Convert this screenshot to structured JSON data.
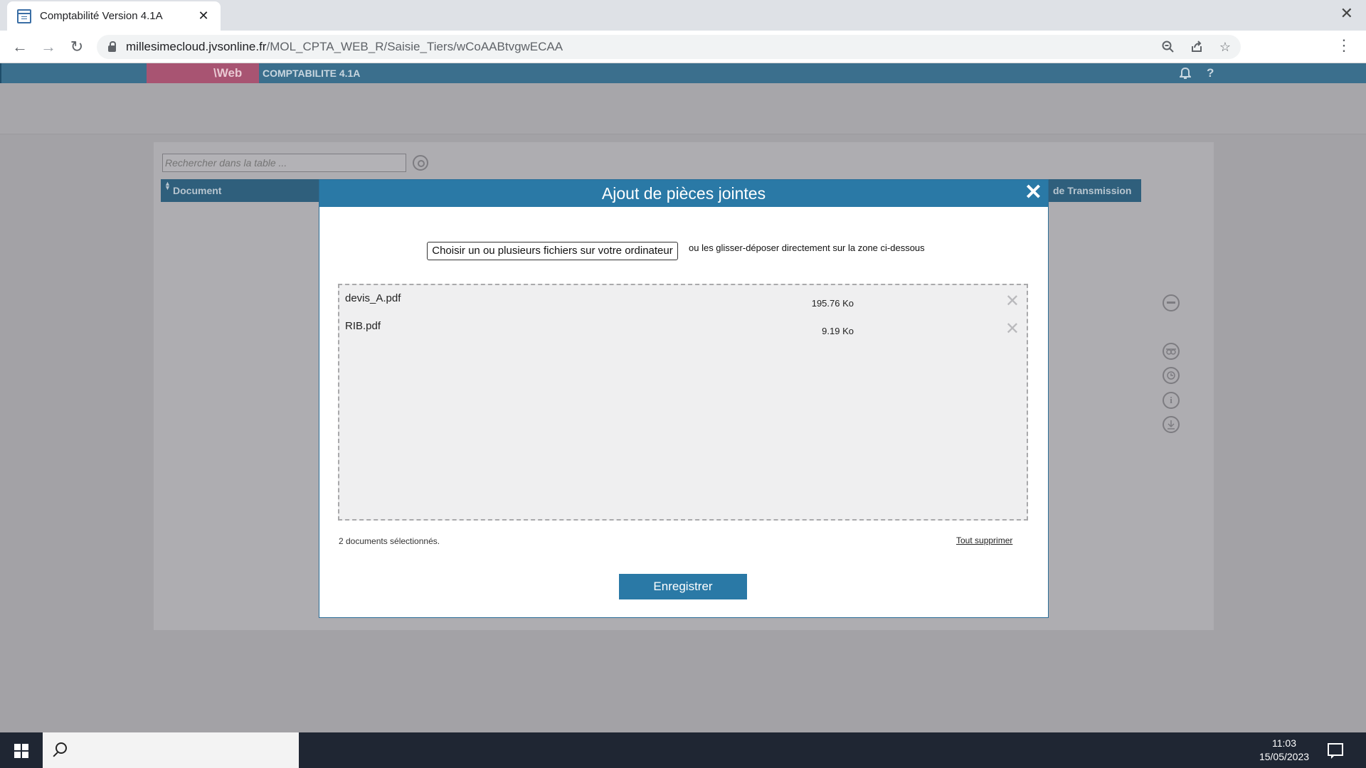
{
  "browser": {
    "tab_title": "Comptabilité Version 4.1A",
    "tab_close": "✕",
    "window_close": "✕",
    "url_host": "millesimecloud.jvsonline.fr",
    "url_path": "/MOL_CPTA_WEB_R/Saisie_Tiers/wCoAABtvgwECAA",
    "icons": [
      "back-icon",
      "forward-icon",
      "reload-icon",
      "lock-icon",
      "zoom-icon",
      "share-icon",
      "star-icon",
      "menu-icon"
    ]
  },
  "app": {
    "brand": "\\Web",
    "title": "COMPTABILITE 4.1A",
    "help": "?"
  },
  "table": {
    "search_placeholder": "Rechercher dans la table ...",
    "col_document": "Document",
    "col_transmission": "de Transmission"
  },
  "side_icons": {
    "info": "i"
  },
  "modal": {
    "title": "Ajout de pièces jointes",
    "close": "✕",
    "choose_button": "Choisir un ou plusieurs fichiers sur votre ordinateur",
    "choose_hint": "ou les glisser-déposer directement sur la zone ci-dessous",
    "files": [
      {
        "name": "devis_A.pdf",
        "size": "195.76 Ko",
        "remove": "✕"
      },
      {
        "name": "RIB.pdf",
        "size": "9.19 Ko",
        "remove": "✕"
      }
    ],
    "count_label": "2 documents sélectionnés.",
    "clear_all": "Tout supprimer",
    "save_button": "Enregistrer"
  },
  "taskbar": {
    "time": "11:03",
    "date": "15/05/2023"
  }
}
